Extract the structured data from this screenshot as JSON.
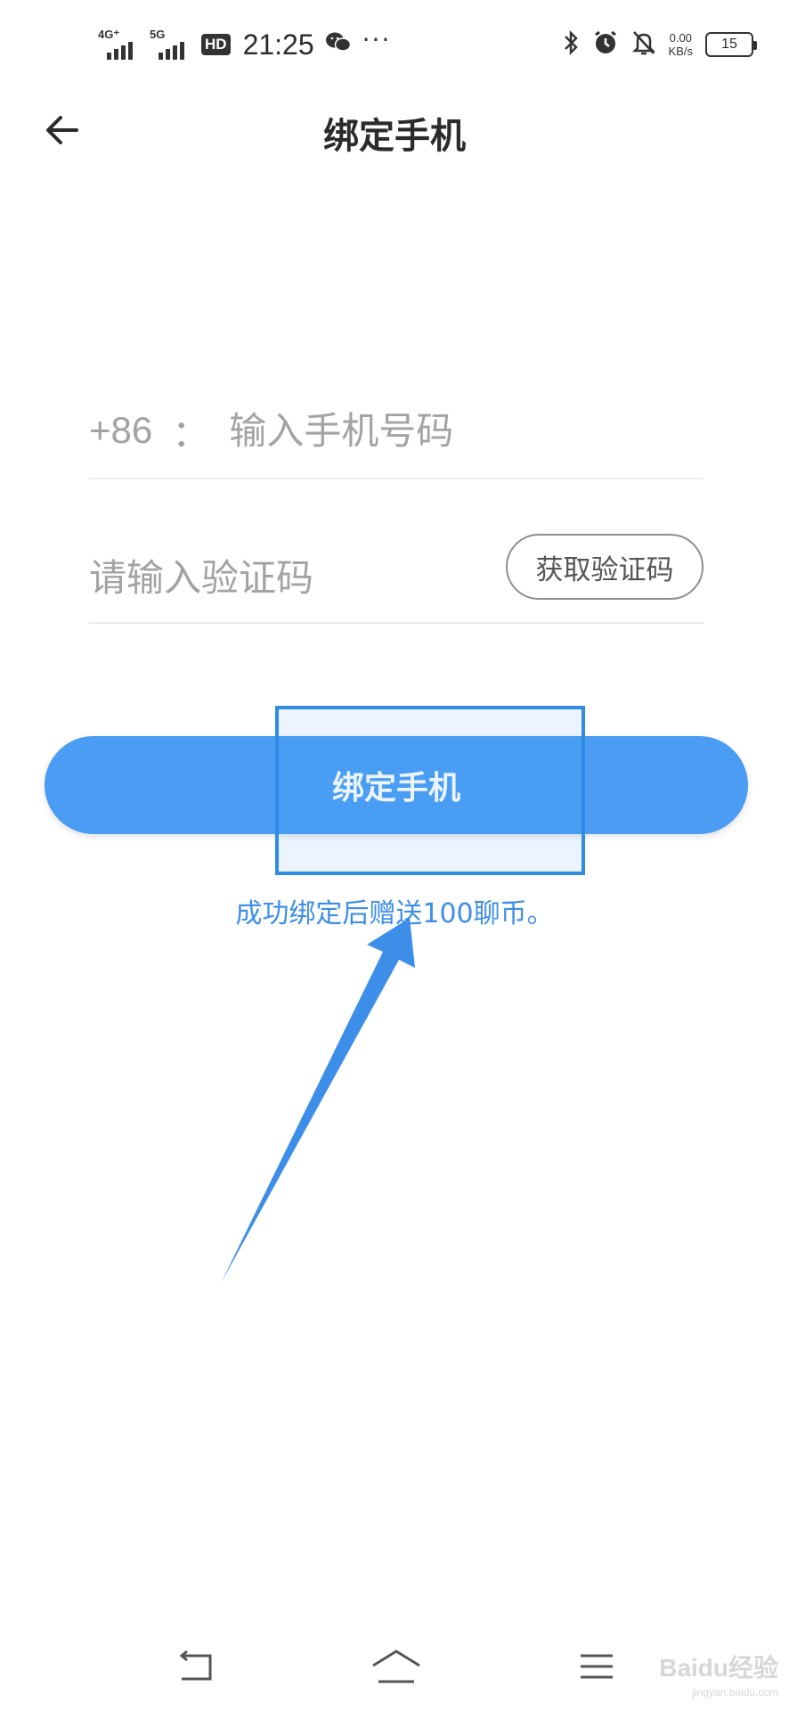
{
  "status_bar": {
    "network_1": "4G⁺",
    "network_2": "5G",
    "hd": "HD",
    "time": "21:25",
    "more": "···",
    "speed_value": "0.00",
    "speed_unit": "KB/s",
    "battery": "15"
  },
  "header": {
    "title": "绑定手机"
  },
  "form": {
    "country_code": "+86",
    "separator": "：",
    "phone_placeholder": "输入手机号码",
    "code_placeholder": "请输入验证码",
    "get_code_label": "获取验证码"
  },
  "bind_button": {
    "label": "绑定手机"
  },
  "bonus_text": "成功绑定后赠送100聊币。",
  "watermark": {
    "brand": "Baidu经验",
    "url": "jingyan.baidu.com"
  },
  "colors": {
    "accent": "#4a9df2",
    "highlight": "#2f8be6",
    "bonus_text": "#3d8ee8"
  },
  "icons": {
    "back": "arrow-left-icon",
    "nav_back": "return-icon",
    "nav_home": "home-icon",
    "nav_menu": "menu-icon"
  }
}
